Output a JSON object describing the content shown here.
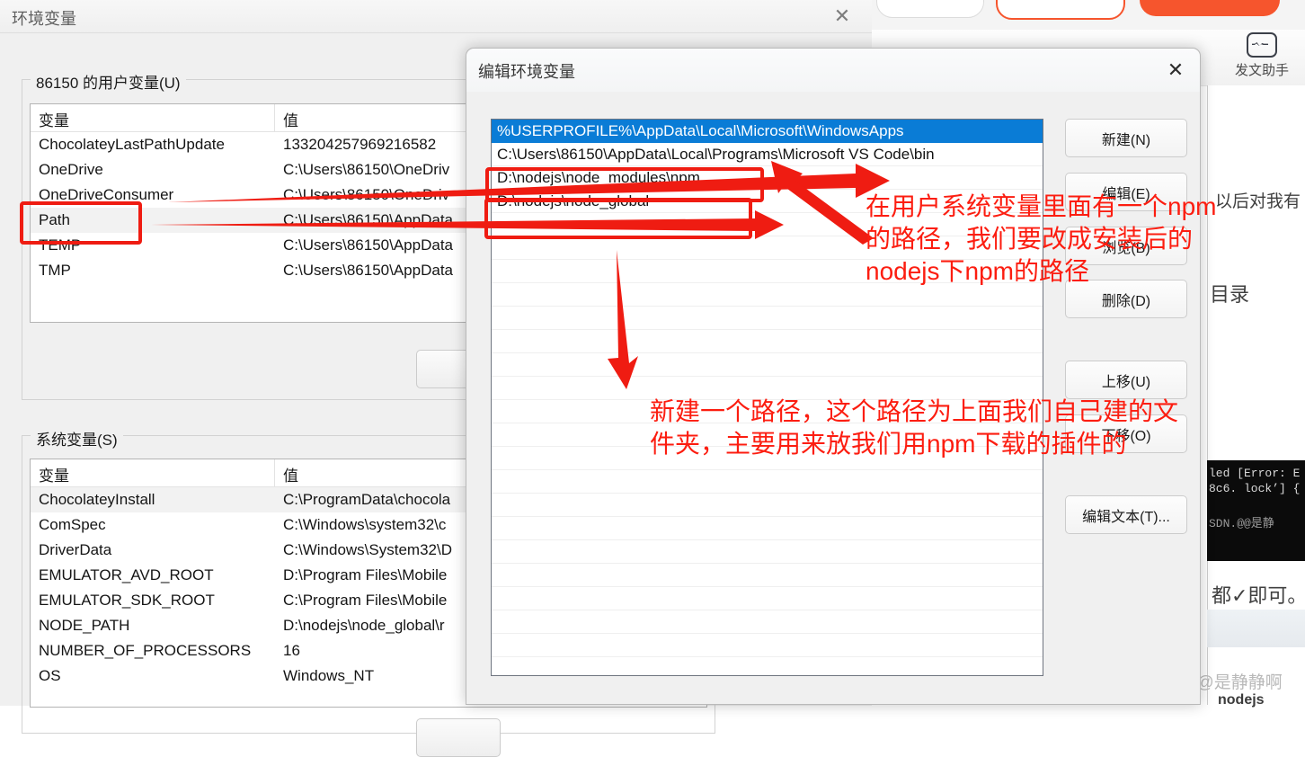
{
  "background": {
    "toolbar": {
      "list_icon": "list-icon",
      "assistant_icon": "pulse-chip-icon",
      "assistant_label": "发文助手"
    },
    "article_fragments": {
      "line1": "以后对我有",
      "line2": "目录",
      "line3": "都✓即可。",
      "terminal_line1": "led [Error: E",
      "terminal_line2": "8c6. lock’] {",
      "terminal_watermark": "SDN.@@是静",
      "bottom_word": "nodejs"
    },
    "watermark": "CSDN @@是静静啊"
  },
  "env_window": {
    "title": "环境变量",
    "close_icon": "close-icon",
    "user_section": {
      "legend": "86150 的用户变量(U)",
      "columns": [
        "变量",
        "值"
      ],
      "rows": [
        {
          "name": "ChocolateyLastPathUpdate",
          "value": "133204257969216582",
          "selected": false
        },
        {
          "name": "OneDrive",
          "value": "C:\\Users\\86150\\OneDriv",
          "selected": false
        },
        {
          "name": "OneDriveConsumer",
          "value": "C:\\Users\\86150\\OneDriv",
          "selected": false
        },
        {
          "name": "Path",
          "value": "C:\\Users\\86150\\AppData",
          "selected": true
        },
        {
          "name": "TEMP",
          "value": "C:\\Users\\86150\\AppData",
          "selected": false
        },
        {
          "name": "TMP",
          "value": "C:\\Users\\86150\\AppData",
          "selected": false
        }
      ]
    },
    "system_section": {
      "legend": "系统变量(S)",
      "columns": [
        "变量",
        "值"
      ],
      "rows": [
        {
          "name": "ChocolateyInstall",
          "value": "C:\\ProgramData\\chocola",
          "selected": true
        },
        {
          "name": "ComSpec",
          "value": "C:\\Windows\\system32\\c",
          "selected": false
        },
        {
          "name": "DriverData",
          "value": "C:\\Windows\\System32\\D",
          "selected": false
        },
        {
          "name": "EMULATOR_AVD_ROOT",
          "value": "D:\\Program Files\\Mobile",
          "selected": false
        },
        {
          "name": "EMULATOR_SDK_ROOT",
          "value": "C:\\Program Files\\Mobile",
          "selected": false
        },
        {
          "name": "NODE_PATH",
          "value": "D:\\nodejs\\node_global\\r",
          "selected": false
        },
        {
          "name": "NUMBER_OF_PROCESSORS",
          "value": "16",
          "selected": false
        },
        {
          "name": "OS",
          "value": "Windows_NT",
          "selected": false
        }
      ]
    }
  },
  "edit_dialog": {
    "title": "编辑环境变量",
    "close_icon": "close-icon",
    "path_entries": [
      {
        "value": "%USERPROFILE%\\AppData\\Local\\Microsoft\\WindowsApps",
        "selected": true
      },
      {
        "value": "C:\\Users\\86150\\AppData\\Local\\Programs\\Microsoft VS Code\\bin",
        "selected": false
      },
      {
        "value": "D:\\nodejs\\node_modules\\npm",
        "selected": false
      },
      {
        "value": "D:\\nodejs\\node_global",
        "selected": false
      },
      {
        "value": "",
        "selected": false
      },
      {
        "value": "",
        "selected": false
      },
      {
        "value": "",
        "selected": false
      },
      {
        "value": "",
        "selected": false
      },
      {
        "value": "",
        "selected": false
      },
      {
        "value": "",
        "selected": false
      },
      {
        "value": "",
        "selected": false
      },
      {
        "value": "",
        "selected": false
      },
      {
        "value": "",
        "selected": false
      },
      {
        "value": "",
        "selected": false
      },
      {
        "value": "",
        "selected": false
      },
      {
        "value": "",
        "selected": false
      },
      {
        "value": "",
        "selected": false
      },
      {
        "value": "",
        "selected": false
      },
      {
        "value": "",
        "selected": false
      },
      {
        "value": "",
        "selected": false
      },
      {
        "value": "",
        "selected": false
      },
      {
        "value": "",
        "selected": false
      },
      {
        "value": "",
        "selected": false
      },
      {
        "value": "",
        "selected": false
      }
    ],
    "buttons": {
      "new": "新建(N)",
      "edit": "编辑(E)",
      "browse": "浏览(B)",
      "delete": "删除(D)",
      "move_up": "上移(U)",
      "move_down": "下移(O)",
      "edit_text": "编辑文本(T)..."
    }
  },
  "annotations": {
    "note1": "在用户系统变量里面有一个npm\n的路径，我们要改成安装后的\nnodejs下npm的路径",
    "note2": "新建一个路径，这个路径为上面我们自己建的文\n件夹，主要用来放我们用npm下载的插件的",
    "color": "#fc1d10"
  }
}
